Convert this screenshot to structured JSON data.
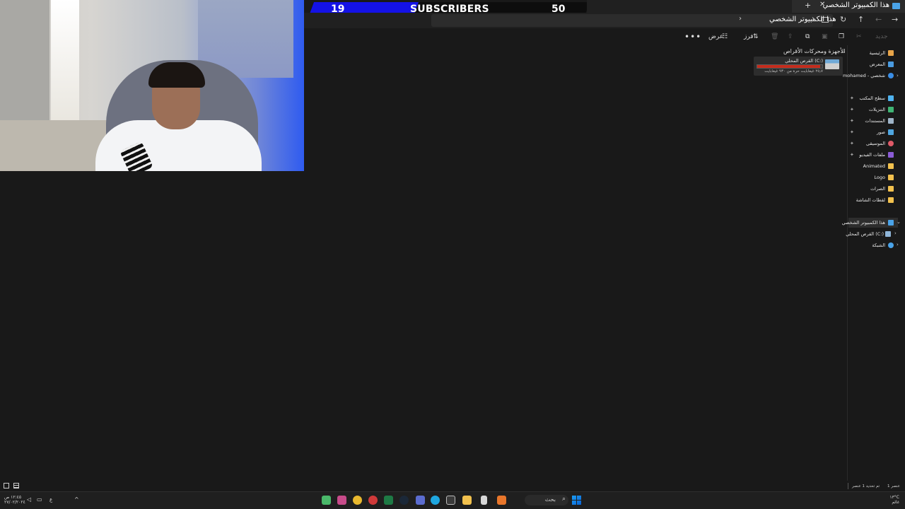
{
  "overlay": {
    "subscribers": {
      "current": "19",
      "label": "SUBSCRIBERS",
      "goal": "50",
      "progress": 0.38,
      "fill_color": "#1412e6"
    }
  },
  "explorer": {
    "window_title": "هذا الكمبيوتر الشخصي",
    "address": {
      "crumbs": [
        "هذا الكمبيوتر الشخصي"
      ]
    },
    "toolbar": {
      "new_label": "جديد",
      "sort_label": "فرز",
      "view_label": "عرض",
      "more_label": "•••"
    },
    "group_header": "الأجهزة ومحركات الأقراص",
    "drive": {
      "name": "القرص المحلي (C:)",
      "free_text": "٢٥٫٧ غيغابايت حرة من ٩٣٠ غيغابايت",
      "used_fraction": 0.97,
      "bar_color": "#c42b1c"
    },
    "sidebar": {
      "top": [
        "الرئيسية",
        "المعرض",
        "mohamed - شخصي"
      ],
      "quick": [
        "سطح المكتب",
        "التنزيلات",
        "المستندات",
        "صور",
        "الموسيقى",
        "ملفات الفيديو",
        "Animated",
        "Logo",
        "الصرات",
        "لقطات الشاشة"
      ],
      "tree": [
        "هذا الكمبيوتر الشخصي",
        "القرص المحلي (C:)",
        "الشبكة"
      ]
    },
    "status": {
      "count": "1 عنصر",
      "selected": "تم تحديد 1 عنصر"
    }
  },
  "taskbar": {
    "search_placeholder": "بحث",
    "weather": {
      "temp": "١٣°C",
      "desc": "غائم"
    },
    "clock": {
      "time": "١٢:٤٥ ص",
      "date": "٢٧/٠٢/٢٠٢٤"
    },
    "lang": "ع"
  },
  "icons": [
    "home-icon",
    "gallery-icon",
    "cloud-icon",
    "desktop-icon",
    "downloads-icon",
    "documents-icon",
    "pictures-icon",
    "music-icon",
    "videos-icon",
    "folder-icon",
    "pc-icon",
    "drive-icon",
    "network-icon",
    "pin-icon",
    "search-icon",
    "start-icon"
  ]
}
